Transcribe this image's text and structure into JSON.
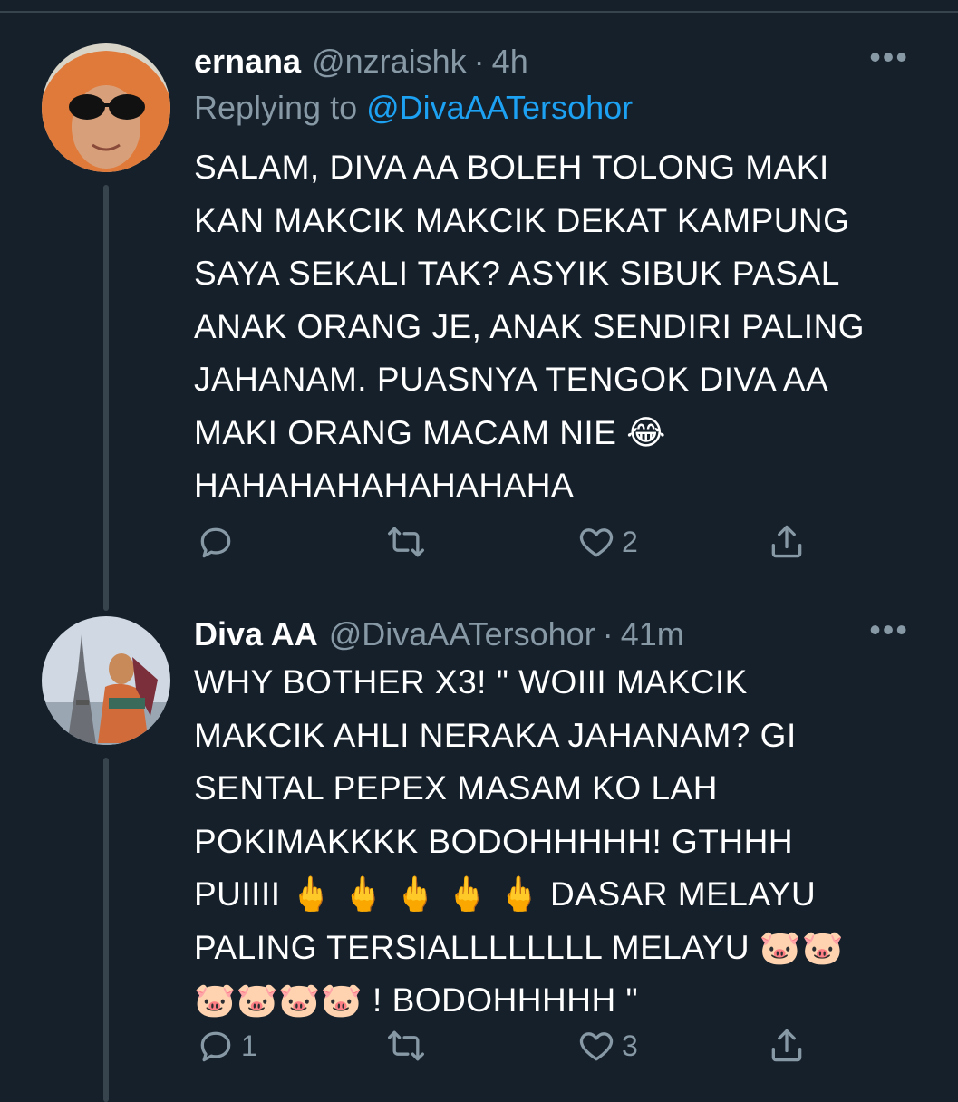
{
  "tweets": [
    {
      "display_name": "ernana",
      "handle": "@nzraishk",
      "separator": "·",
      "time": "4h",
      "replying_label": "Replying to",
      "replying_mention": "@DivaAATersohor",
      "text": "SALAM, DIVA AA BOLEH TOLONG MAKI\nKAN MAKCIK MAKCIK DEKAT KAMPUNG\nSAYA SEKALI TAK? ASYIK SIBUK PASAL\nANAK ORANG JE, ANAK SENDIRI PALING\nJAHANAM. PUASNYA TENGOK DIVA AA\nMAKI ORANG MACAM NIE 😂\nHAHAHAHAHAHAHAHA",
      "reply_count": "",
      "retweet_count": "",
      "like_count": "2",
      "more": "•••"
    },
    {
      "display_name": "Diva AA",
      "handle": "@DivaAATersohor",
      "separator": "·",
      "time": "41m",
      "text": "WHY BOTHER X3! \" WOIII MAKCIK\nMAKCIK AHLI NERAKA JAHANAM? GI\nSENTAL PEPEX MASAM KO LAH\nPOKIMAKKKK BODOHHHHH! GTHHH\nPUIIII 🖕 🖕 🖕 🖕 🖕  DASAR MELAYU\nPALING TERSIALLLLLLLL MELAYU 🐷🐷\n🐷🐷🐷🐷 ! BODOHHHHH \"",
      "reply_count": "1",
      "retweet_count": "",
      "like_count": "3",
      "more": "•••"
    }
  ],
  "icons": [
    "reply-icon",
    "retweet-icon",
    "like-icon",
    "share-icon",
    "more-icon"
  ],
  "colors": {
    "background": "#15202b",
    "text": "#ffffff",
    "secondary": "#8899a6",
    "link": "#1da1f2",
    "divider": "#38444d"
  }
}
